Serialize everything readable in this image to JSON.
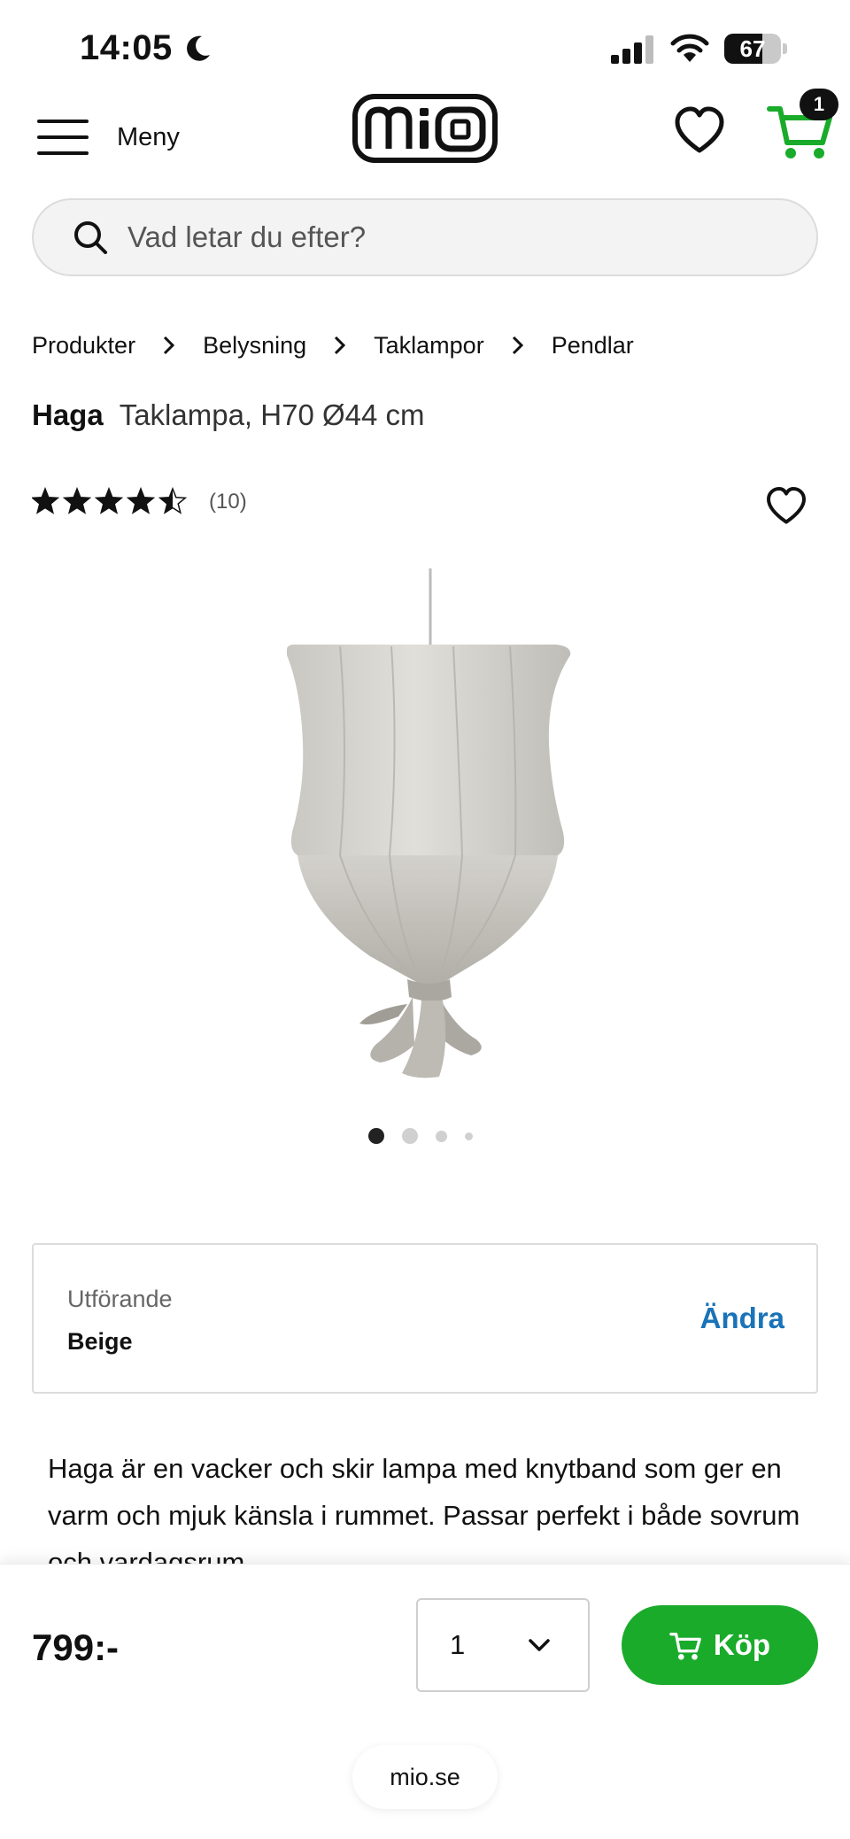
{
  "status_bar": {
    "time": "14:05",
    "battery": "67",
    "battery_level": 0.67
  },
  "header": {
    "menu_label": "Meny",
    "logo_text": "mio",
    "cart_count": "1",
    "colors": {
      "cart": "#1aab2b"
    }
  },
  "search": {
    "placeholder": "Vad letar du efter?"
  },
  "breadcrumb": {
    "items": [
      "Produkter",
      "Belysning",
      "Taklampor",
      "Pendlar"
    ]
  },
  "product": {
    "brand": "Haga",
    "description_title": "Taklampa, H70 Ø44 cm",
    "rating": 4.5,
    "rating_count": "(10)",
    "image_count": 4,
    "active_image": 1
  },
  "variant": {
    "label": "Utförande",
    "value": "Beige",
    "change_label": "Ändra",
    "colors": {
      "change": "#1a73b8"
    }
  },
  "description": {
    "text": "Haga är en vacker och skir lampa med knytband som ger en varm och mjuk känsla i rummet. Passar perfekt i både sovrum och vardagsrum."
  },
  "buy_bar": {
    "price": "799:-",
    "quantity": "1",
    "buy_label": "Köp",
    "colors": {
      "buy_button": "#1aab2b"
    }
  },
  "browser": {
    "url": "mio.se"
  }
}
